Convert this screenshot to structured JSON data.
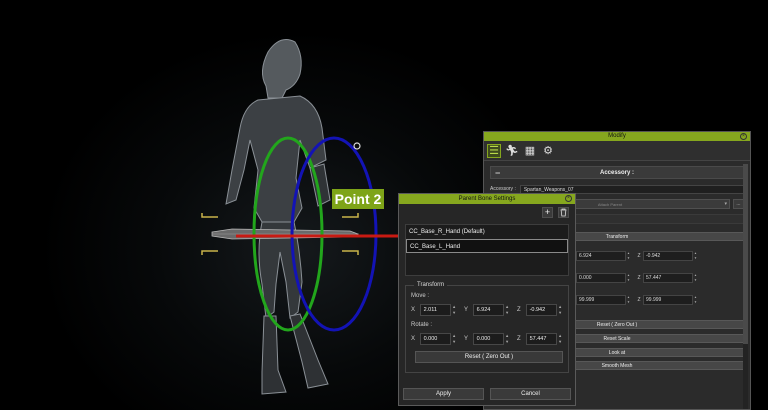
{
  "viewport": {
    "point_label": "Point 2",
    "colors": {
      "label_bg": "#7ea418",
      "ring_green": "#22a61c",
      "ring_blue": "#1313b5",
      "axis_red": "#c81a12",
      "bracket": "#c9b44a"
    }
  },
  "modify_panel": {
    "title": "Modify",
    "tabs": [
      {
        "icon": "sliders-icon",
        "active": true
      },
      {
        "icon": "running-figure-icon",
        "active": false
      },
      {
        "icon": "checker-grid-icon",
        "active": false
      },
      {
        "icon": "gear-cluster-icon",
        "active": false
      }
    ],
    "section_title": "Accessory :",
    "accessory_label": "Accessory :",
    "accessory_value": "Spartan_Weapons_07",
    "attach_dropdown": "Attach Parent",
    "dots_label": "...",
    "transform_label": "Transform",
    "rows": [
      {
        "y": "6.924",
        "z": "-0.942"
      },
      {
        "y": "0.000",
        "z": "57.447"
      },
      {
        "y": "99.999",
        "z": "99.999"
      }
    ],
    "axis_y": "Y",
    "axis_z": "Z",
    "reset_zero": "Reset ( Zero Out )",
    "reset_scale": "Reset Scale",
    "look_at": "Look at",
    "smooth_mesh": "Smooth Mesh"
  },
  "parent_bone_dialog": {
    "title": "Parent Bone Settings",
    "add_label": "+",
    "bones": [
      "CC_Base_R_Hand (Default)",
      "CC_Base_L_Hand"
    ],
    "selected_index": 1,
    "group_title": "Transform",
    "move_label": "Move :",
    "rotate_label": "Rotate :",
    "axis_x": "X",
    "axis_y": "Y",
    "axis_z": "Z",
    "move": {
      "x": "2.011",
      "y": "6.924",
      "z": "-0.942"
    },
    "rotate": {
      "x": "0.000",
      "y": "0.000",
      "z": "57.447"
    },
    "reset_label": "Reset ( Zero Out )",
    "apply_label": "Apply",
    "cancel_label": "Cancel"
  }
}
